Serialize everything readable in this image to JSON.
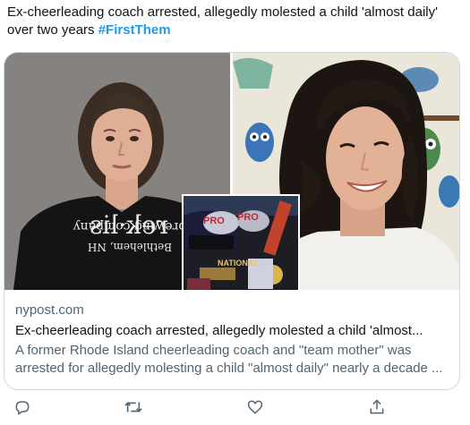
{
  "tweet": {
    "text": "Ex-cheerleading coach arrested, allegedly molested a child 'almost daily' over two years ",
    "hashtag": "#FirstThem"
  },
  "card": {
    "domain": "nypost.com",
    "title": "Ex-cheerleading coach arrested, allegedly molested a child 'almost...",
    "description": "A former Rhode Island cheerleading coach and \"team mother\" was arrested for allegedly molesting a child \"almost daily\" nearly a decade ...",
    "images": {
      "left_shirt_line1": "rek·lis",
      "left_shirt_line2": "brewing company",
      "left_shirt_line3": "Bethlehem, NH",
      "inset_text1": "PRO",
      "inset_text2": "PRO",
      "inset_text3": "NATIONAL"
    }
  },
  "actions": {
    "reply_icon": "reply-icon",
    "retweet_icon": "retweet-icon",
    "like_icon": "like-icon",
    "share_icon": "share-icon"
  },
  "colors": {
    "link": "#1d9bf0",
    "secondary_text": "#536471",
    "border": "#cfd9de"
  }
}
